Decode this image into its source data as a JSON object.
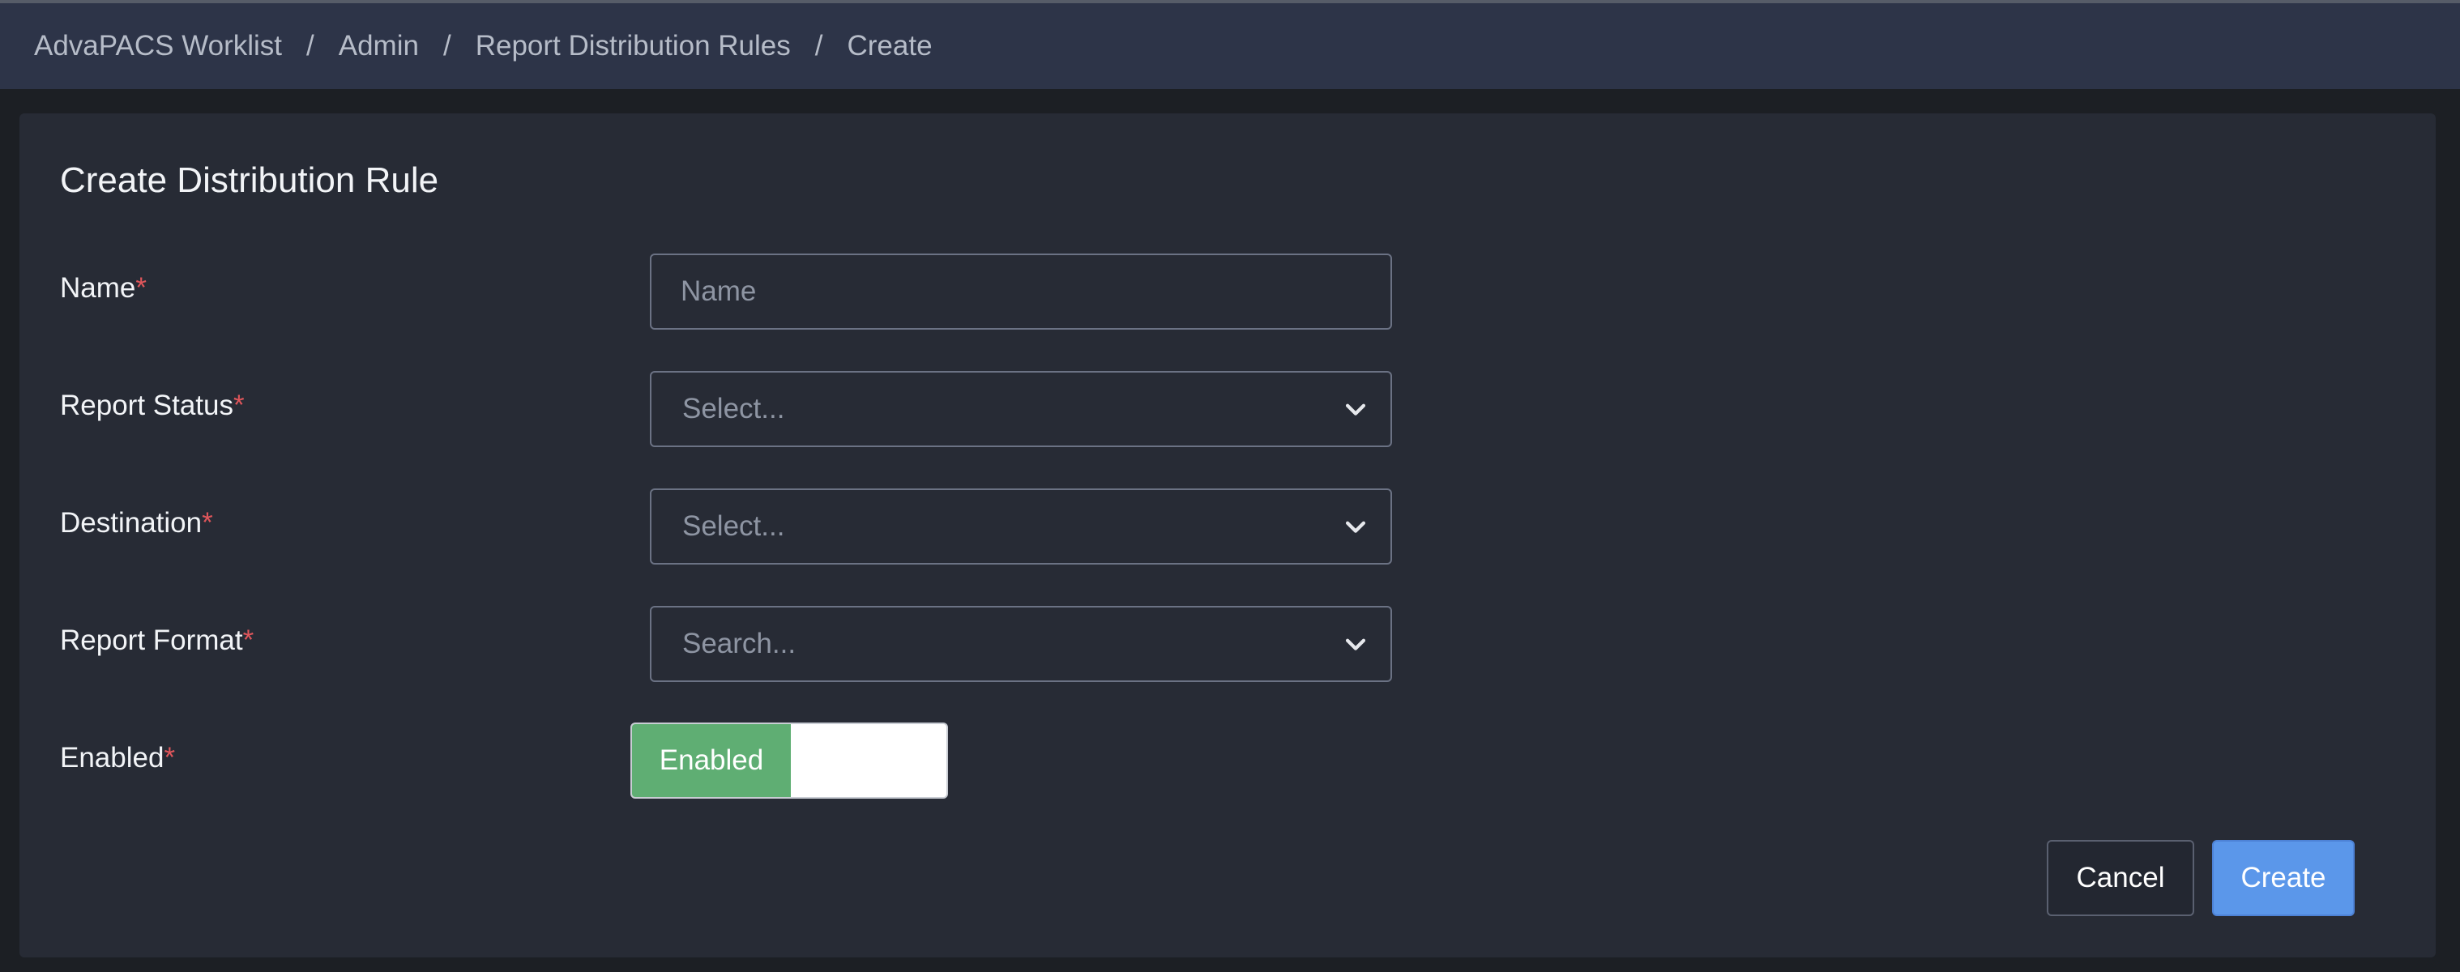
{
  "breadcrumb": {
    "items": [
      "AdvaPACS Worklist",
      "Admin",
      "Report Distribution Rules",
      "Create"
    ],
    "separator": "/"
  },
  "form": {
    "title": "Create Distribution Rule",
    "required_marker": "*",
    "name": {
      "label": "Name",
      "placeholder": "Name",
      "value": ""
    },
    "report_status": {
      "label": "Report Status",
      "placeholder": "Select..."
    },
    "destination": {
      "label": "Destination",
      "placeholder": "Select..."
    },
    "report_format": {
      "label": "Report Format",
      "placeholder": "Search..."
    },
    "enabled": {
      "label": "Enabled",
      "toggle_label": "Enabled",
      "state": true
    }
  },
  "actions": {
    "cancel_label": "Cancel",
    "create_label": "Create"
  },
  "colors": {
    "accent": "#5b97ea",
    "toggle_on": "#5fae73",
    "required": "#e0565b"
  },
  "icons": {
    "select_chevron": "chevron-down-icon"
  }
}
